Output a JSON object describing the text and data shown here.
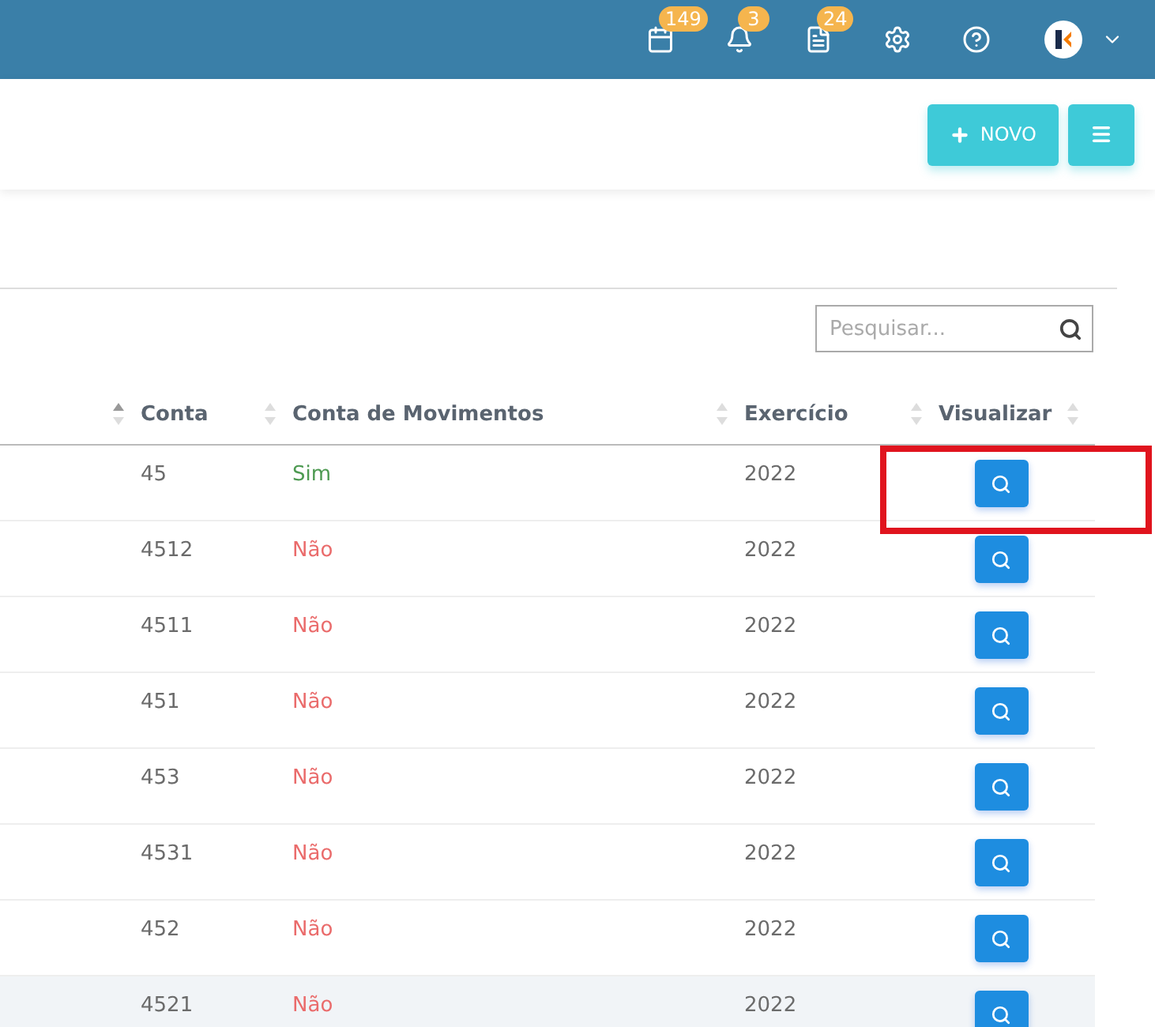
{
  "topbar": {
    "badges": [
      {
        "kind": "calendar",
        "count": "149"
      },
      {
        "kind": "bell",
        "count": "3"
      },
      {
        "kind": "document",
        "count": "24"
      }
    ],
    "tools": [
      {
        "kind": "settings"
      },
      {
        "kind": "help"
      }
    ]
  },
  "actions": {
    "new_button": "NOVO"
  },
  "search": {
    "placeholder": "Pesquisar..."
  },
  "table": {
    "columns": [
      {
        "sorted": true
      },
      {
        "label": "Conta",
        "sorted": false
      },
      {
        "label": "Conta de Movimentos",
        "sorted": false
      },
      {
        "label": "Exercício",
        "sorted": false
      },
      {
        "label": "Visualizar",
        "sorted": false
      }
    ],
    "rows": [
      {
        "conta": "45",
        "movimentos": "Sim",
        "positive": true,
        "exercicio": "2022",
        "hovered": false,
        "highlighted": true
      },
      {
        "conta": "4512",
        "movimentos": "Não",
        "positive": false,
        "exercicio": "2022",
        "hovered": false,
        "highlighted": false
      },
      {
        "conta": "4511",
        "movimentos": "Não",
        "positive": false,
        "exercicio": "2022",
        "hovered": false,
        "highlighted": false
      },
      {
        "conta": "451",
        "movimentos": "Não",
        "positive": false,
        "exercicio": "2022",
        "hovered": false,
        "highlighted": false
      },
      {
        "conta": "453",
        "movimentos": "Não",
        "positive": false,
        "exercicio": "2022",
        "hovered": false,
        "highlighted": false
      },
      {
        "conta": "4531",
        "movimentos": "Não",
        "positive": false,
        "exercicio": "2022",
        "hovered": false,
        "highlighted": false
      },
      {
        "conta": "452",
        "movimentos": "Não",
        "positive": false,
        "exercicio": "2022",
        "hovered": false,
        "highlighted": false
      },
      {
        "conta": "4521",
        "movimentos": "Não",
        "positive": false,
        "exercicio": "2022",
        "hovered": true,
        "highlighted": false
      }
    ]
  }
}
